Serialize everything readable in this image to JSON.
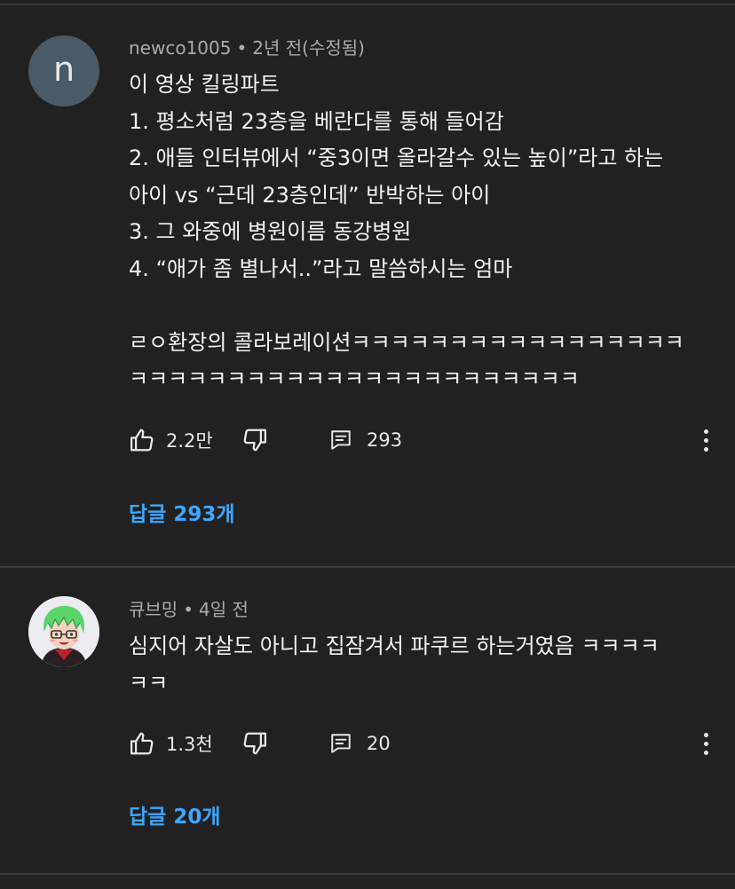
{
  "comments": [
    {
      "avatar_letter": "n",
      "author": "newco1005",
      "time": "2년 전(수정됨)",
      "text": "이 영상 킬링파트\n1. 평소처럼 23층을 베란다를 통해 들어감\n2. 애들 인터뷰에서 “중3이면 올라갈수 있는 높이”라고 하는\n아이 vs “근데 23층인데” 반박하는 아이\n3. 그 와중에 병원이름 동강병원\n4. “애가 좀 별나서..”라고 말씀하시는 엄마\n\nㄹㅇ환장의 콜라보레이션ㅋㅋㅋㅋㅋㅋㅋㅋㅋㅋㅋㅋㅋㅋㅋㅋㅋ\nㅋㅋㅋㅋㅋㅋㅋㅋㅋㅋㅋㅋㅋㅋㅋㅋㅋㅋㅋㅋㅋㅋㅋ",
      "likes": "2.2만",
      "reply_count": "293",
      "replies_label": "답글 293개"
    },
    {
      "avatar_icon": "cartoon-avatar-green-hair",
      "author": "큐브밍",
      "time": "4일 전",
      "text": "심지어 자살도 아니고 집잠겨서 파쿠르 하는거였음 ㅋㅋㅋㅋ\nㅋㅋ",
      "likes": "1.3천",
      "reply_count": "20",
      "replies_label": "답글 20개"
    }
  ],
  "icons": {
    "like": "thumbs-up-icon",
    "dislike": "thumbs-down-icon",
    "reply": "comment-icon",
    "more": "more-vert-icon"
  },
  "colors": {
    "background": "#212121",
    "accent": "#3ea6ff",
    "meta": "#aaaaaa",
    "text": "#f1f1f1"
  },
  "separator": "•"
}
